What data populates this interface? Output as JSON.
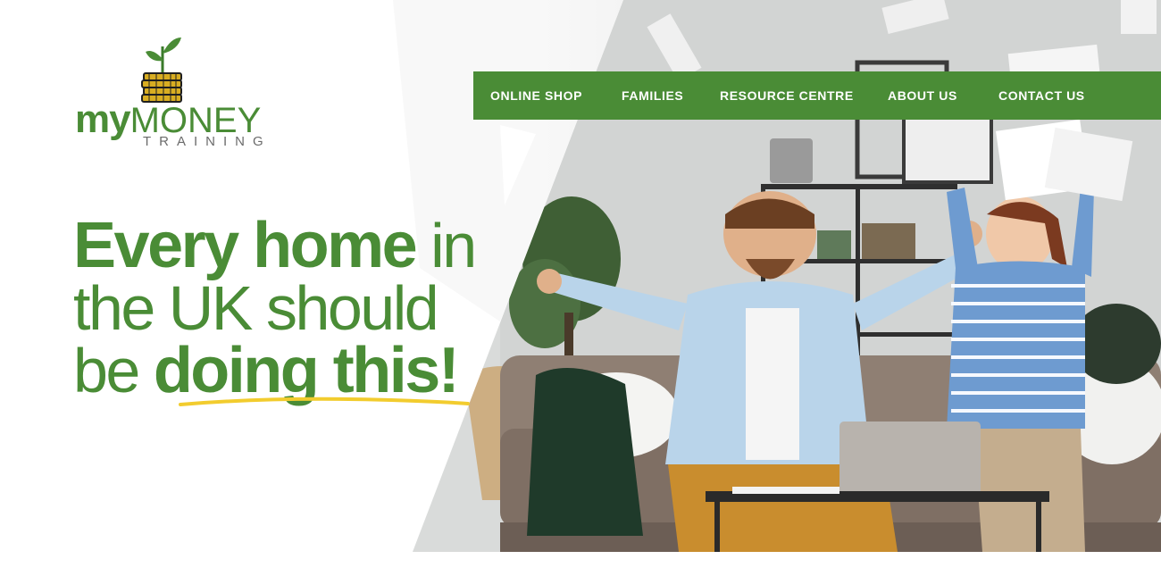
{
  "brand": {
    "logo_primary_bold": "my",
    "logo_primary_regular": "MONEY",
    "logo_secondary": "TRAINING",
    "green": "#4a8c36",
    "gold": "#d8ad22",
    "underline_yellow": "#f2cc2e"
  },
  "nav": {
    "items": [
      {
        "label": "ONLINE SHOP"
      },
      {
        "label": "FAMILIES"
      },
      {
        "label": "RESOURCE CENTRE"
      },
      {
        "label": "ABOUT US"
      },
      {
        "label": "CONTACT US"
      }
    ]
  },
  "hero": {
    "headline": {
      "line1_bold": "Every home",
      "line1_light": " in",
      "line2_light": "the UK should",
      "line3_light": "be ",
      "line3_bold": "doing this!"
    },
    "photo_description_icon": "family-celebrating-photo"
  }
}
